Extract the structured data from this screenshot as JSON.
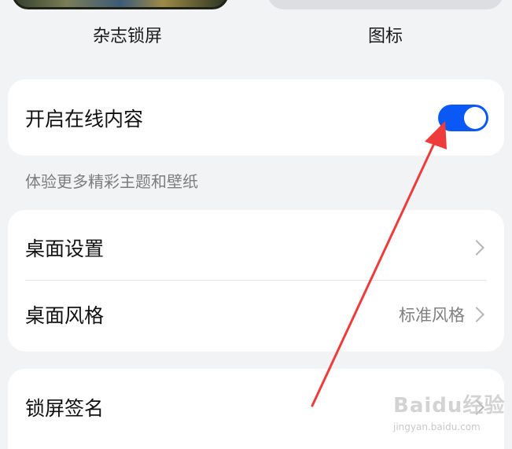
{
  "top_tiles": {
    "magazine_label": "杂志锁屏",
    "icons_label": "图标"
  },
  "online_content": {
    "title": "开启在线内容",
    "toggle_on": true,
    "toggle_color": "#0a59f7",
    "hint": "体验更多精彩主题和壁纸"
  },
  "desktop_card": {
    "settings_label": "桌面设置",
    "style_label": "桌面风格",
    "style_value": "标准风格"
  },
  "lock_card": {
    "signature_label": "锁屏签名"
  },
  "annotation": {
    "arrow_color": "#ee3b3b"
  },
  "watermark": {
    "brand": "Baidu经验",
    "url": "jingyan.baidu.com"
  }
}
